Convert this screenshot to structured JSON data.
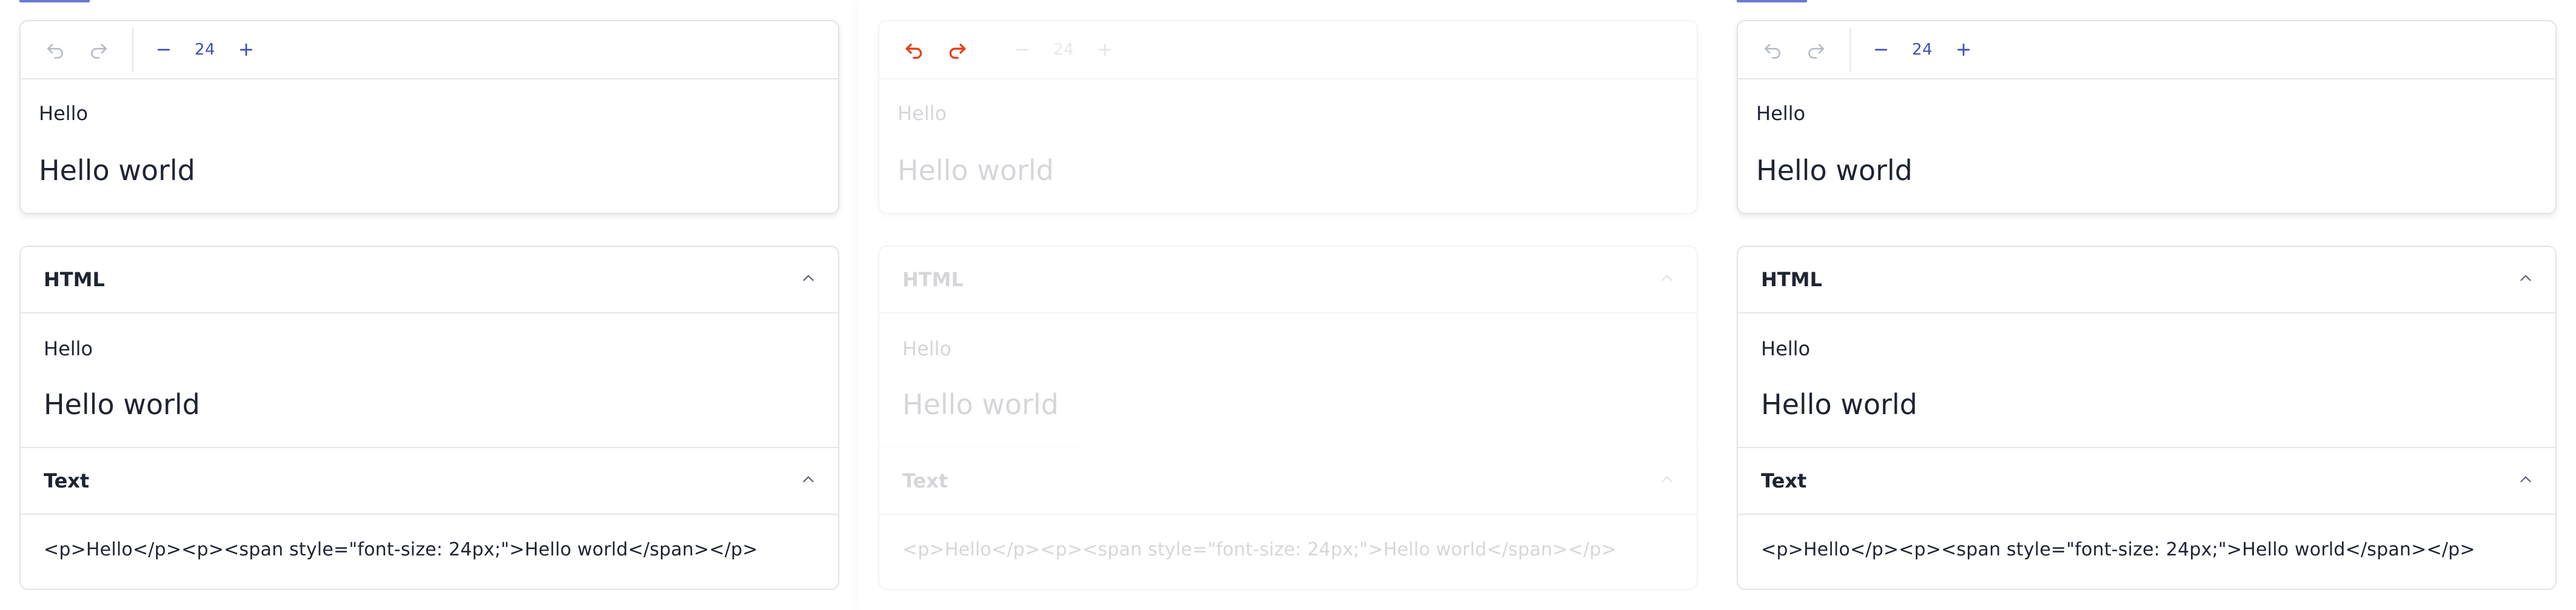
{
  "colors": {
    "accent": "#3f51b5",
    "undo_active": "#e8401c",
    "disabled_icon": "#b7bcc8",
    "border": "#dfe3ea",
    "text": "#1f2433"
  },
  "panels": [
    {
      "state": "normal",
      "toolbar": {
        "undo_icon": "undo-icon",
        "redo_icon": "redo-icon",
        "decrease_icon": "minus-icon",
        "increase_icon": "plus-icon",
        "font_size": "24"
      },
      "editor": {
        "line1": "Hello",
        "line2": "Hello world"
      },
      "html_section": {
        "title": "HTML",
        "line1": "Hello",
        "line2": "Hello world"
      },
      "text_section": {
        "title": "Text",
        "code": "<p>Hello</p><p><span style=\"font-size: 24px;\">Hello world</span></p>"
      }
    },
    {
      "state": "faded",
      "toolbar": {
        "undo_icon": "undo-icon",
        "redo_icon": "redo-icon",
        "decrease_icon": "minus-icon",
        "increase_icon": "plus-icon",
        "font_size": "24"
      },
      "editor": {
        "line1": "Hello",
        "line2": "Hello world"
      },
      "html_section": {
        "title": "HTML",
        "line1": "Hello",
        "line2": "Hello world"
      },
      "text_section": {
        "title": "Text",
        "code": "<p>Hello</p><p><span style=\"font-size: 24px;\">Hello world</span></p>"
      }
    },
    {
      "state": "normal",
      "toolbar": {
        "undo_icon": "undo-icon",
        "redo_icon": "redo-icon",
        "decrease_icon": "minus-icon",
        "increase_icon": "plus-icon",
        "font_size": "24"
      },
      "editor": {
        "line1": "Hello",
        "line2": "Hello world"
      },
      "html_section": {
        "title": "HTML",
        "line1": "Hello",
        "line2": "Hello world"
      },
      "text_section": {
        "title": "Text",
        "code": "<p>Hello</p><p><span style=\"font-size: 24px;\">Hello world</span></p>"
      }
    }
  ]
}
